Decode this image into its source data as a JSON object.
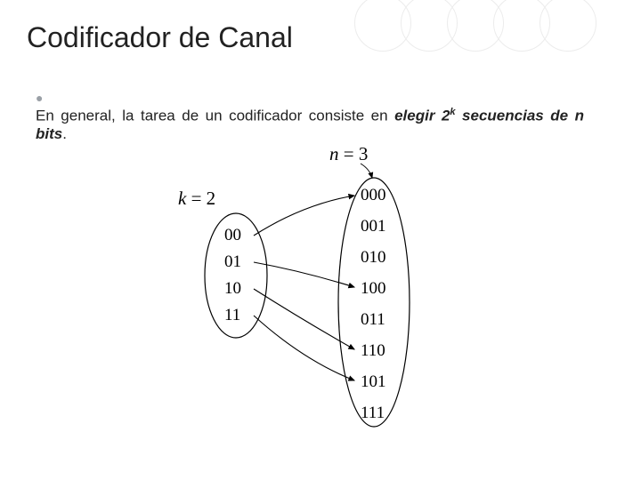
{
  "title": "Codificador de Canal",
  "bullet": {
    "pre": "En general, la tarea de un codificador consiste en ",
    "emph_a": "elegir 2",
    "sup": "k",
    "post_emph": " secuencias de n bits",
    "period": "."
  },
  "diagram": {
    "k_label_var": "k",
    "k_label_eq": " = 2",
    "n_label_var": "n",
    "n_label_eq": " = 3",
    "left_seq": [
      "00",
      "01",
      "10",
      "11"
    ],
    "right_seq": [
      "000",
      "001",
      "010",
      "100",
      "011",
      "110",
      "101",
      "111"
    ]
  }
}
